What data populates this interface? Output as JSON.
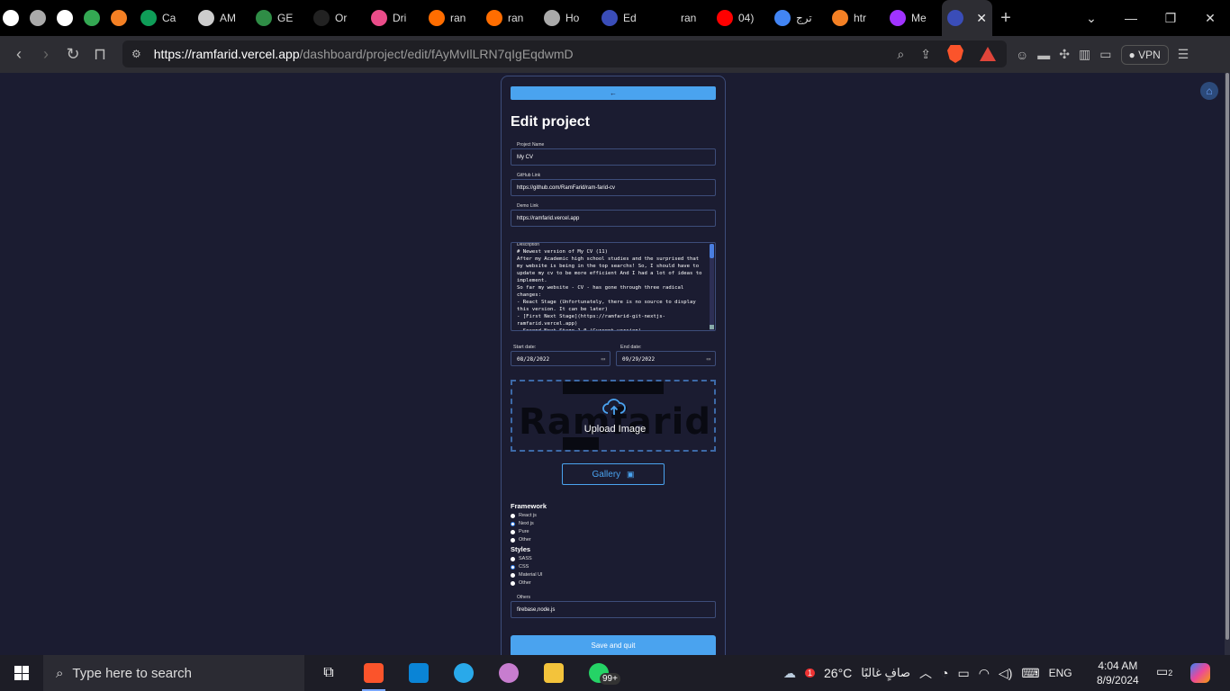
{
  "tabs": [
    {
      "label": "",
      "icon": "github-icon"
    },
    {
      "label": "",
      "icon": "globe-icon"
    },
    {
      "label": "",
      "icon": "github-icon"
    },
    {
      "label": "",
      "icon": "chrome-icon"
    },
    {
      "label": "",
      "icon": "stack-icon"
    },
    {
      "label": "Ca",
      "icon": "sheets-icon"
    },
    {
      "label": "AM",
      "icon": "check-icon"
    },
    {
      "label": "GE",
      "icon": "geeks-icon"
    },
    {
      "label": "Or",
      "icon": "st-icon"
    },
    {
      "label": "Dri",
      "icon": "dribbble-icon"
    },
    {
      "label": "ran",
      "icon": "fire-icon"
    },
    {
      "label": "ran",
      "icon": "fire-icon"
    },
    {
      "label": "Ho",
      "icon": "globe-icon"
    },
    {
      "label": "Ed",
      "icon": "ninja-icon"
    },
    {
      "label": "ran",
      "icon": "vercel-icon"
    },
    {
      "label": "04)",
      "icon": "youtube-icon"
    },
    {
      "label": "ترج",
      "icon": "translate-icon"
    },
    {
      "label": "htr",
      "icon": "stack-icon"
    },
    {
      "label": "Me",
      "icon": "messenger-icon"
    },
    {
      "label": "",
      "icon": "ninja-icon",
      "active": true
    }
  ],
  "url": {
    "host": "https://ramfarid.vercel.app",
    "path": "/dashboard/project/edit/fAyMvIlLRN7qIgEqdwmD"
  },
  "toolbar": {
    "vpn_label": "VPN"
  },
  "form": {
    "back_arrow": "←",
    "title": "Edit project",
    "project_name_label": "Project Name",
    "project_name": "My CV",
    "github_label": "GitHub Link",
    "github_value": "https://github.com/RamFarid/ram-farid-cv",
    "demo_label": "Demo Link",
    "demo_value": "https://ramfarid.vercel.app",
    "description_label": "Description",
    "description": "# Newest version of My CV (11)\nAfter my Academic high school studies and the surprised that my website is being in the top searchs! So, I should have to update my cv to be more efficient And I had a lot of ideas to implement.\nSo far my website - CV - has gone through three radical changes:\n- React Stage (Unfortunately, there is no source to display this version. It can be later)\n- [First Next Stage](https://ramfarid-git-nextjs-ramfarid.vercel.app)\n- Second Next Stage 1.0 (Current version)",
    "start_label": "Start date:",
    "start_value": "08/28/2022",
    "end_label": "End date:",
    "end_value": "09/29/2022",
    "upload_label": "Upload Image",
    "logo_text": "Ramfarid",
    "gallery_label": "Gallery",
    "framework_title": "Framework",
    "framework_options": [
      "React js",
      "Next js",
      "Pure",
      "Other"
    ],
    "framework_selected": "Next js",
    "styles_title": "Styles",
    "styles_options": [
      "SASS",
      "CSS",
      "Material UI",
      "Other"
    ],
    "styles_selected": "CSS",
    "others_label": "Others",
    "others_value": "firebase,node.js",
    "save_label": "Save and quit"
  },
  "taskbar": {
    "search_placeholder": "Type here to search",
    "badge": "99+",
    "weather_temp": "26°C",
    "weather_desc": "صافٍ غالبًا",
    "weather_alert": "1",
    "lang": "ENG",
    "time": "4:04 AM",
    "date": "8/9/2024",
    "notifications": "2"
  },
  "colors": {
    "accent": "#4aa3ef",
    "page_bg": "#1b1c31",
    "border": "#3d4d7a"
  }
}
